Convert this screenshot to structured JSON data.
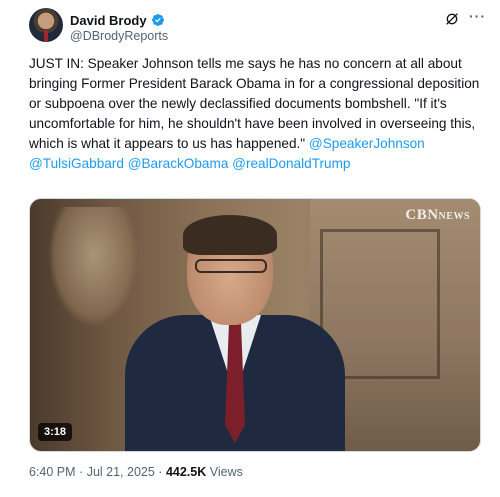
{
  "author": {
    "display_name": "David Brody",
    "handle": "@DBrodyReports",
    "verified": true
  },
  "icons": {
    "verified": "verified-badge-icon",
    "grok": "grok-icon",
    "more": "more-options-icon"
  },
  "tweet": {
    "text_main": "JUST IN: Speaker Johnson tells me says he has no concern at all about bringing Former President Barack Obama in for a congressional deposition or subpoena over the newly declassified documents bombshell. \"If it's uncomfortable for him, he shouldn't have been involved in overseeing this, which is what it appears to us has happened.\"",
    "mentions": [
      "@SpeakerJohnson",
      "@TulsiGabbard",
      "@BarackObama",
      "@realDonaldTrump"
    ]
  },
  "media": {
    "watermark": "CBN",
    "watermark_suffix": "NEWS",
    "duration": "3:18"
  },
  "meta": {
    "time": "6:40 PM",
    "date": "Jul 21, 2025",
    "separator": "·",
    "views_count": "442.5K",
    "views_label": "Views"
  },
  "colors": {
    "link": "#1d9bf0",
    "verified": "#1d9bf0",
    "text": "#0f1419",
    "secondary": "#536471"
  }
}
